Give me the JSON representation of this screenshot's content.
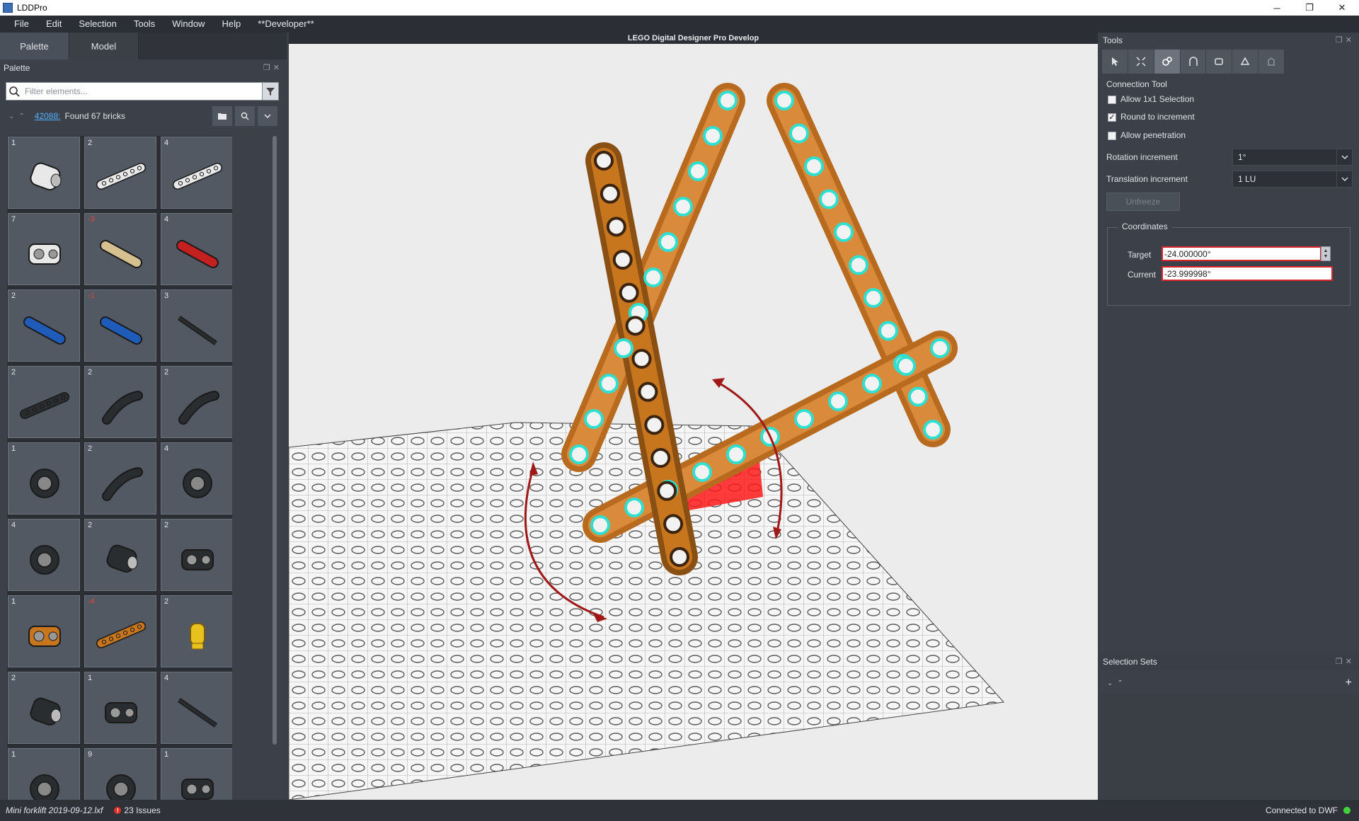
{
  "window": {
    "title": "LDDPro",
    "minimize": "─",
    "restore": "❐",
    "close": "✕"
  },
  "menu": [
    "File",
    "Edit",
    "Selection",
    "Tools",
    "Window",
    "Help",
    "**Developer**"
  ],
  "left_panel": {
    "tabs": [
      "Palette",
      "Model"
    ],
    "active_tab": "Palette",
    "panel_title": "Palette",
    "filter_placeholder": "Filter elements...",
    "set_link": "42088:",
    "found_text": "Found 67 bricks",
    "bricks": [
      {
        "count": "1",
        "negative": false,
        "icon": "pin-connector",
        "color": "#e8e8e8"
      },
      {
        "count": "2",
        "negative": false,
        "icon": "beam-7",
        "color": "#e8e8e8"
      },
      {
        "count": "4",
        "negative": false,
        "icon": "beam-7",
        "color": "#e8e8e8"
      },
      {
        "count": "7",
        "negative": false,
        "icon": "cross-block",
        "color": "#e8e8e8"
      },
      {
        "count": "-3",
        "negative": true,
        "icon": "axle-pin",
        "color": "#d6c08f"
      },
      {
        "count": "4",
        "negative": false,
        "icon": "axle-pin-long",
        "color": "#c42020"
      },
      {
        "count": "2",
        "negative": false,
        "icon": "axle-pin",
        "color": "#1f5bb8"
      },
      {
        "count": "-1",
        "negative": true,
        "icon": "axle-pin",
        "color": "#1f5bb8"
      },
      {
        "count": "3",
        "negative": false,
        "icon": "axle",
        "color": "#2a2d30"
      },
      {
        "count": "2",
        "negative": false,
        "icon": "beam-5",
        "color": "#2a2d30"
      },
      {
        "count": "2",
        "negative": false,
        "icon": "l-beam",
        "color": "#2a2d30"
      },
      {
        "count": "2",
        "negative": false,
        "icon": "curved-beam",
        "color": "#2a2d30"
      },
      {
        "count": "1",
        "negative": false,
        "icon": "gear",
        "color": "#2a2d30"
      },
      {
        "count": "2",
        "negative": false,
        "icon": "curved-beam",
        "color": "#2a2d30"
      },
      {
        "count": "4",
        "negative": false,
        "icon": "gear",
        "color": "#2a2d30"
      },
      {
        "count": "4",
        "negative": false,
        "icon": "bush",
        "color": "#2a2d30"
      },
      {
        "count": "2",
        "negative": false,
        "icon": "pin-connector",
        "color": "#2a2d30"
      },
      {
        "count": "2",
        "negative": false,
        "icon": "cross-block",
        "color": "#2a2d30"
      },
      {
        "count": "1",
        "negative": false,
        "icon": "cross-block",
        "color": "#c8761e"
      },
      {
        "count": "-4",
        "negative": true,
        "icon": "beam-15",
        "color": "#c8761e"
      },
      {
        "count": "2",
        "negative": false,
        "icon": "light",
        "color": "#e8c21c"
      },
      {
        "count": "2",
        "negative": false,
        "icon": "pin-connector",
        "color": "#2a2d30"
      },
      {
        "count": "1",
        "negative": false,
        "icon": "cross-block",
        "color": "#2a2d30"
      },
      {
        "count": "4",
        "negative": false,
        "icon": "axle",
        "color": "#2a2d30"
      },
      {
        "count": "1",
        "negative": false,
        "icon": "bush",
        "color": "#2a2d30"
      },
      {
        "count": "9",
        "negative": false,
        "icon": "wheel",
        "color": "#2a2d30"
      },
      {
        "count": "1",
        "negative": false,
        "icon": "cross-block",
        "color": "#2a2d30"
      }
    ]
  },
  "viewport": {
    "title": "LEGO Digital Designer Pro Develop"
  },
  "tools_panel": {
    "title": "Tools",
    "toolbar_icons": [
      "select-icon",
      "fit-icon",
      "connection-icon",
      "hinge-icon",
      "flex-icon",
      "clone-icon",
      "paint-icon"
    ],
    "section": "Connection Tool",
    "checkboxes": [
      {
        "label": "Allow 1x1 Selection",
        "checked": false
      },
      {
        "label": "Round to increment",
        "checked": true
      },
      {
        "label": "Allow penetration",
        "checked": false
      }
    ],
    "rotation_label": "Rotation increment",
    "rotation_value": "1°",
    "translation_label": "Translation increment",
    "translation_value": "1 LU",
    "unfreeze": "Unfreeze",
    "coords_title": "Coordinates",
    "target_label": "Target",
    "target_value": "-24.000000°",
    "current_label": "Current",
    "current_value": "-23.999998°"
  },
  "selection_sets": {
    "title": "Selection Sets",
    "add": "+"
  },
  "status": {
    "file": "Mini forklift 2019-09-12.lxf",
    "issues": "23 Issues",
    "connection": "Connected to DWF"
  },
  "colors": {
    "accent": "#4fb0ff",
    "beam": "#c8761e",
    "highlight": "#2fe0d0",
    "error": "#d8262c"
  }
}
